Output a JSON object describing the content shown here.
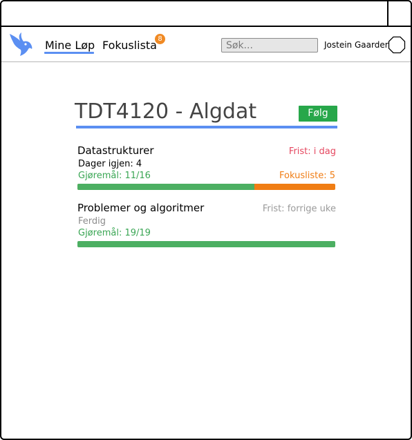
{
  "nav": {
    "mine_lop": "Mine Løp",
    "fokuslista": "Fokuslista",
    "fokuslista_badge": "8",
    "search_placeholder": "Søk...",
    "user_name": "Jostein Gaarder"
  },
  "course": {
    "title": "TDT4120 - Algdat",
    "follow_label": "Følg"
  },
  "runs": [
    {
      "name": "Datastrukturer",
      "deadline": "Frist: i dag",
      "days_left": "Dager igjen: 4",
      "tasks": "Gjøremål: 11/16",
      "focus": "Fokusliste: 5",
      "progress_fraction": 0.6875
    },
    {
      "name": "Problemer og algoritmer",
      "deadline": "Frist: forrige uke",
      "status": "Ferdig",
      "tasks": "Gjøremål: 19/19",
      "progress_fraction": 1.0
    }
  ],
  "colors": {
    "accent_blue": "#5b8ff2",
    "follow_green": "#27a74a",
    "progress_green": "#4caf62",
    "focus_orange": "#f07d14",
    "deadline_red": "#e5475f",
    "muted_gray": "#9a9a9a"
  },
  "icons": {
    "logo": "gazelle-logo-icon",
    "avatar": "hexagon-avatar-icon"
  }
}
